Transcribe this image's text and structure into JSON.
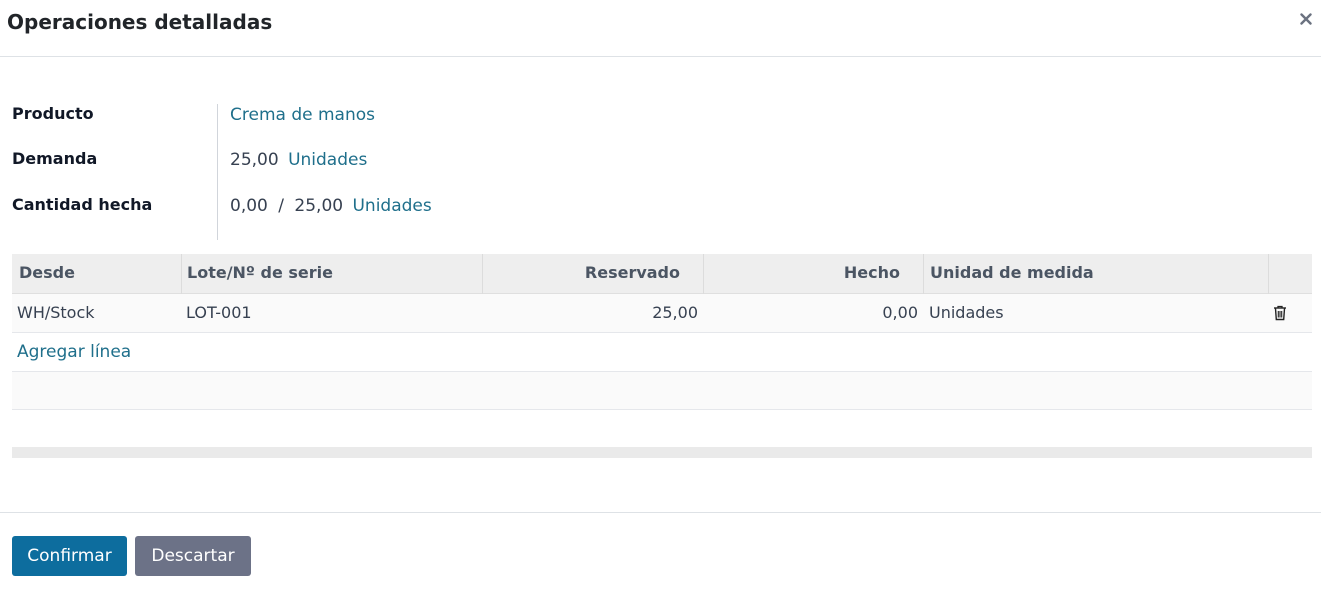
{
  "dialog": {
    "title": "Operaciones detalladas"
  },
  "fields": {
    "product_label": "Producto",
    "product_value": "Crema de manos",
    "demand_label": "Demanda",
    "demand_value": "25,00",
    "demand_uom": "Unidades",
    "done_label": "Cantidad hecha",
    "done_value": "0,00",
    "done_separator": "/",
    "done_total": "25,00",
    "done_uom": "Unidades"
  },
  "table": {
    "headers": [
      "Desde",
      "Lote/Nº de serie",
      "Reservado",
      "Hecho",
      "Unidad de medida"
    ],
    "rows": [
      {
        "from": "WH/Stock",
        "lot": "LOT-001",
        "reserved": "25,00",
        "done": "0,00",
        "uom": "Unidades"
      }
    ],
    "add_line": "Agregar línea"
  },
  "footer": {
    "confirm": "Confirmar",
    "discard": "Descartar"
  },
  "icons": {
    "close": "close-icon",
    "delete": "trash-icon"
  },
  "colors": {
    "link": "#1f6f8b",
    "primary": "#0d6d9e",
    "secondary": "#6c7287"
  }
}
